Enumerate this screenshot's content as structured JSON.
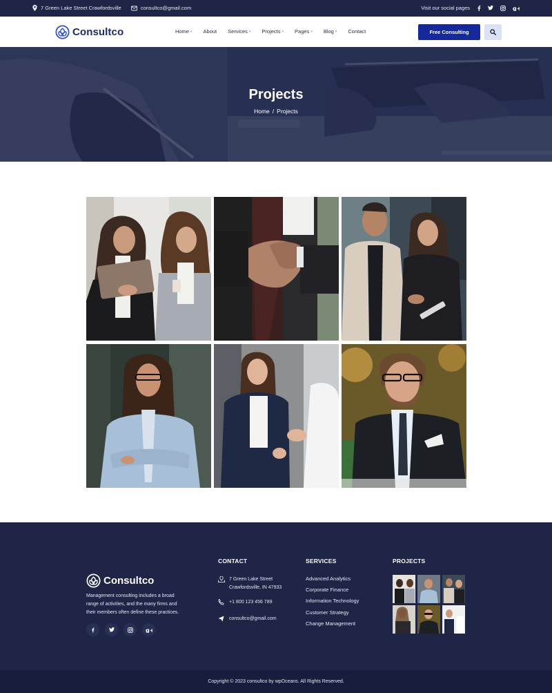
{
  "topbar": {
    "address": "7 Green Lake Street Crawfordsville",
    "email": "consultco@gmail.com",
    "social_label": "Visit our social pages",
    "social_icons": [
      "facebook-icon",
      "twitter-icon",
      "instagram-icon",
      "google-plus-icon"
    ]
  },
  "header": {
    "brand": "Consultco",
    "nav": [
      {
        "label": "Home",
        "has_dropdown": true
      },
      {
        "label": "About",
        "has_dropdown": false
      },
      {
        "label": "Services",
        "has_dropdown": true
      },
      {
        "label": "Projects",
        "has_dropdown": true
      },
      {
        "label": "Pages",
        "has_dropdown": true
      },
      {
        "label": "Blog",
        "has_dropdown": true
      },
      {
        "label": "Contact",
        "has_dropdown": false
      }
    ],
    "cta_label": "Free Consulting",
    "search_icon": "search-icon"
  },
  "hero": {
    "title": "Projects",
    "breadcrumb_home": "Home",
    "breadcrumb_sep": "/",
    "breadcrumb_current": "Projects"
  },
  "gallery": {
    "items": [
      "two women with tablet and coffee",
      "business handshake close-up",
      "man and woman looking at tablet",
      "woman with glasses arms crossed",
      "smiling woman shaking hands",
      "man with glasses in suit"
    ]
  },
  "footer": {
    "brand": "Consultco",
    "description": "Management consulting includes a broad range of activities, and the many firms and their members often define these practices.",
    "social_icons": [
      "facebook-icon",
      "twitter-icon",
      "instagram-icon",
      "google-plus-icon"
    ],
    "contact_title": "CONTACT",
    "contact": {
      "address_line1": "7 Green Lake Street",
      "address_line2": "Crawfordsville, IN 47933",
      "phone": "+1 800 123 456 789",
      "email": "consultco@gmail.com"
    },
    "services_title": "SERVICES",
    "services": [
      "Advanced Analytics",
      "Corporate Finance",
      "Information Technology",
      "Customer Strategy",
      "Change Management"
    ],
    "projects_title": "PROJECTS",
    "copyright": "Copyright © 2023 consultco by wpOceans. All Rights Reserved."
  },
  "colors": {
    "navy": "#1e2547",
    "brand_blue": "#15299a",
    "logo_blue": "#1e2a6e",
    "search_bg": "#dbe2f5"
  }
}
